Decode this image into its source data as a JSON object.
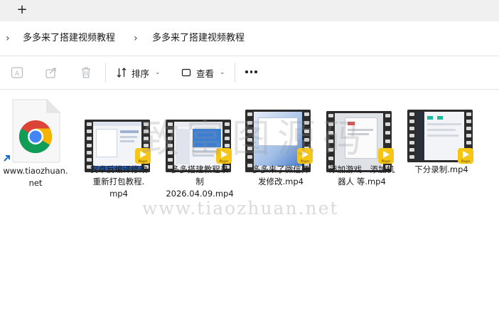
{
  "tabbar": {
    "new_tab_icon": "plus-icon"
  },
  "breadcrumb": {
    "items": [
      "多多来了搭建视频教程",
      "多多来了搭建视频教程"
    ]
  },
  "toolbar": {
    "translate_icon": "ai-translate-icon",
    "share_icon": "share-icon",
    "delete_icon": "trash-icon",
    "sort_label": "排序",
    "view_label": "查看",
    "more_icon": "more-icon"
  },
  "files": [
    {
      "name_lines": [
        "www.tiaozhuan.",
        "net"
      ],
      "type": "chrome-shortcut"
    },
    {
      "name_lines": [
        "安卓反编译修改",
        "重新打包教程.",
        "mp4"
      ],
      "type": "video",
      "badge": "Player"
    },
    {
      "name_lines": [
        "多多搭建教程录",
        "制",
        "2026.04.09.mp4"
      ],
      "type": "video",
      "badge": "Player"
    },
    {
      "name_lines": [
        "多多来了微信开",
        "发修改.mp4"
      ],
      "type": "video",
      "badge": "Player"
    },
    {
      "name_lines": [
        "添加游戏　添加机",
        "器人 等.mp4"
      ],
      "type": "video",
      "badge": "Player"
    },
    {
      "name_lines": [
        "下分录制.mp4"
      ],
      "type": "video",
      "badge": "Player"
    }
  ],
  "watermark": {
    "cn": "致富图源码",
    "url": "www.tiaozhuan.net"
  },
  "colors": {
    "accent": "#0067c0",
    "badge": "#f5c518"
  }
}
